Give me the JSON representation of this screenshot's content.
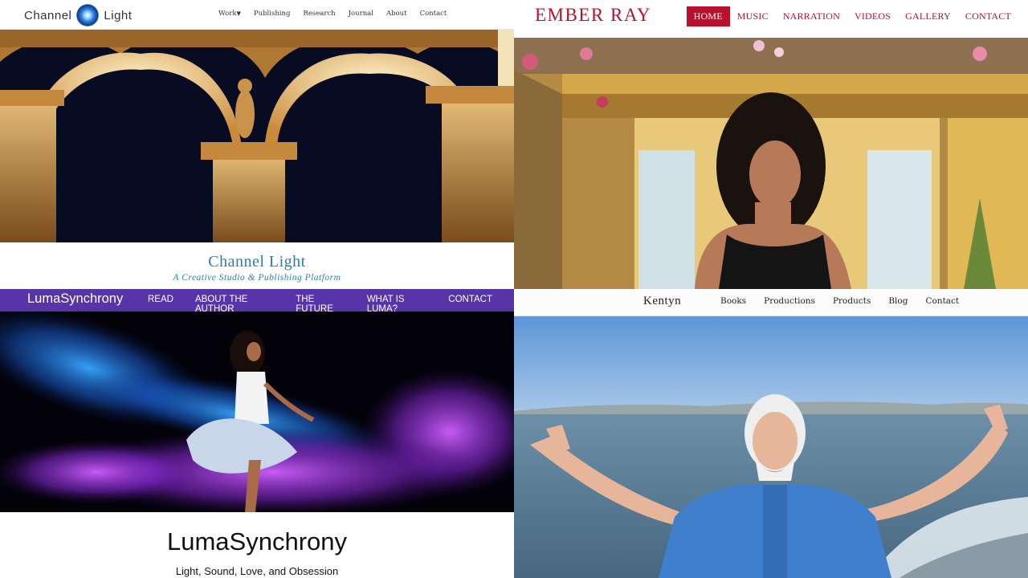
{
  "channel_light": {
    "logo_left": "Channel",
    "logo_right": "Light",
    "nav": [
      "Work",
      "Publishing",
      "Research",
      "Journal",
      "About",
      "Contact"
    ],
    "title": "Channel Light",
    "subtitle": "A Creative Studio & Publishing Platform",
    "slide_count": 2,
    "active_slide": 1,
    "colors": {
      "accent": "#2d7fa8",
      "hero_sky": "#070b1e",
      "arch": "#d9a24a"
    }
  },
  "ember_ray": {
    "logo": "EMBER RAY",
    "nav": [
      "HOME",
      "MUSIC",
      "NARRATION",
      "VIDEOS",
      "GALLERY",
      "CONTACT"
    ],
    "active_nav": "HOME",
    "colors": {
      "accent": "#b8102d"
    }
  },
  "luma_synchrony": {
    "logo": "LumaSynchrony",
    "nav": [
      "READ",
      "ABOUT THE AUTHOR",
      "THE FUTURE",
      "WHAT IS LUMA?",
      "CONTACT"
    ],
    "title": "LumaSynchrony",
    "subtitle": "Light, Sound, Love, and Obsession",
    "colors": {
      "header": "#5834a9",
      "particles_blue": "#1e8cff",
      "particles_purple": "#b040e8"
    }
  },
  "kentyn": {
    "logo": "Kentyn",
    "nav": [
      "Books",
      "Productions",
      "Products",
      "Blog",
      "Contact"
    ],
    "colors": {
      "sky": "#8fb8e6",
      "sea": "#5d86a6",
      "shirt": "#3d7cc9"
    }
  }
}
